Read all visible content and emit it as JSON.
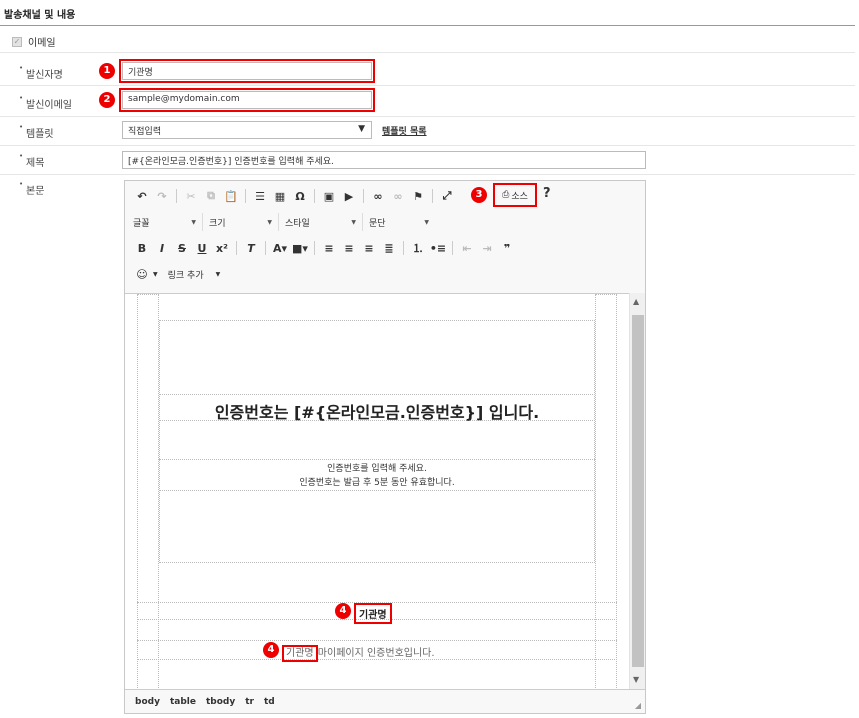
{
  "section": {
    "title": "발송채널 및 내용"
  },
  "channel": {
    "email_label": "이메일",
    "email_checked": true
  },
  "sender_name": {
    "label": "발신자명",
    "value": "기관명",
    "badge": "1"
  },
  "sender_email": {
    "label": "발신이메일",
    "value": "sample@mydomain.com",
    "badge": "2"
  },
  "template": {
    "label": "템플릿",
    "selected": "직접입력",
    "link": "템플릿 목록"
  },
  "subject": {
    "label": "제목",
    "value": "[#{온라인모금.인증번호}] 인증번호를 입력해 주세요."
  },
  "body": {
    "label": "본문"
  },
  "editor": {
    "source_label": "소스",
    "source_badge": "3",
    "help": "?",
    "combos": {
      "font": "글꼴",
      "size": "크기",
      "style": "스타일",
      "paragraph": "문단"
    },
    "link_add": "링크 추가",
    "heading": "인증번호는 [#{온라인모금.인증번호}] 입니다.",
    "body_line1": "인증번호를 입력해 주세요.",
    "body_line2": "인증번호는 발급 후 5분 동안 유효합니다.",
    "org_name": "기관명",
    "org_badge": "4",
    "footer_org": "기관명",
    "footer_rest": " 마이페이지 인증번호입니다.",
    "footer_badge": "4",
    "path": [
      "body",
      "table",
      "tbody",
      "tr",
      "td"
    ]
  },
  "colors": {
    "highlight": "#e00000",
    "badge": "#e00000"
  }
}
